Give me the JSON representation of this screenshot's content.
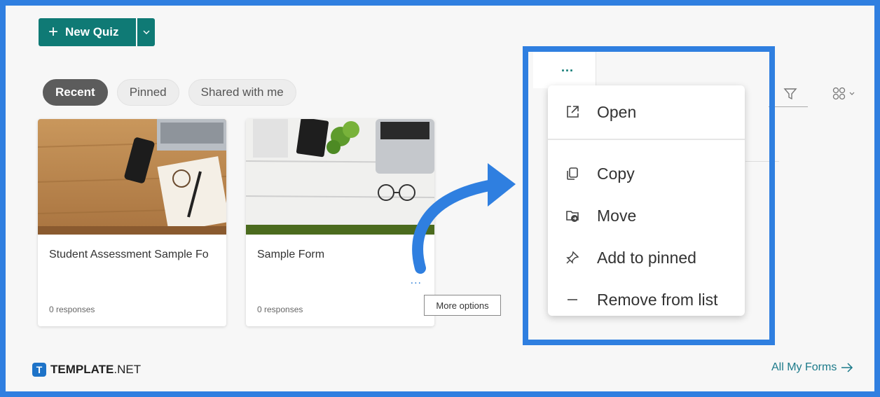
{
  "toolbar": {
    "new_quiz_label": "New Quiz",
    "plus_icon": "plus-icon",
    "dropdown_icon": "chevron-down-icon"
  },
  "filters": [
    {
      "label": "Recent",
      "active": true
    },
    {
      "label": "Pinned",
      "active": false
    },
    {
      "label": "Shared with me",
      "active": false
    }
  ],
  "cards": [
    {
      "title": "Student Assessment Sample Fo",
      "responses": "0 responses"
    },
    {
      "title": "Sample Form",
      "responses": "0 responses",
      "more": "..."
    }
  ],
  "tooltip": "More options",
  "header": {
    "more": "..."
  },
  "menu": {
    "items": [
      {
        "label": "Open",
        "icon": "open-external-icon"
      },
      {
        "label": "Copy",
        "icon": "copy-icon"
      },
      {
        "label": "Move",
        "icon": "move-icon"
      },
      {
        "label": "Add to pinned",
        "icon": "pin-icon"
      },
      {
        "label": "Remove from list",
        "icon": "minus-icon"
      }
    ]
  },
  "brand": {
    "bold": "TEMPLATE",
    "rest": ".NET",
    "mark": "T"
  },
  "footer": {
    "all_forms": "All My Forms"
  },
  "colors": {
    "accent": "#0f7a75",
    "highlight": "#2f7fe0",
    "link": "#1c7a8a"
  }
}
